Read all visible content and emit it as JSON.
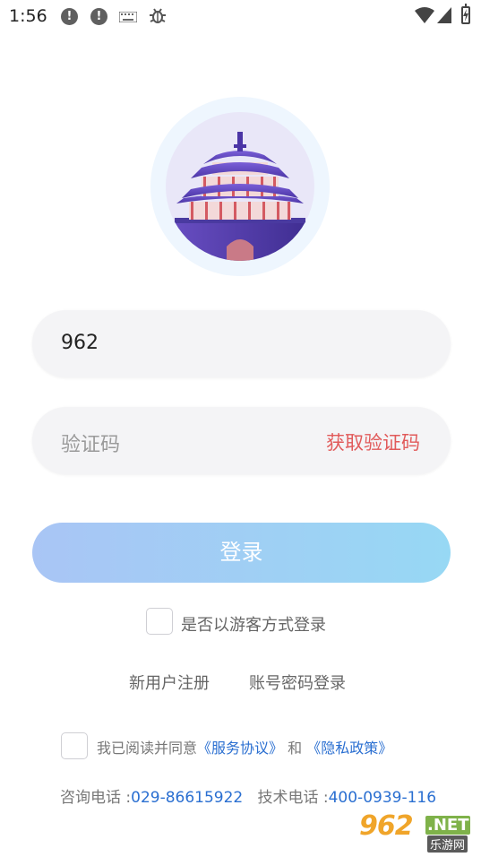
{
  "status_bar": {
    "time": "1:56",
    "icons": [
      "alert-icon",
      "alert-icon",
      "keyboard-icon",
      "bug-icon",
      "wifi-icon",
      "signal-icon",
      "battery-icon"
    ]
  },
  "logo": {
    "icon": "city-gate-tower-icon"
  },
  "phone_field": {
    "value": "962"
  },
  "code_field": {
    "placeholder": "验证码",
    "get_code_label": "获取验证码"
  },
  "login_button": {
    "label": "登录"
  },
  "guest": {
    "label": "是否以游客方式登录",
    "checked": false
  },
  "links": {
    "register": "新用户注册",
    "password_login": "账号密码登录"
  },
  "agreement": {
    "checked": false,
    "prefix": "我已阅读并同意",
    "service": "《服务协议》",
    "and": "和",
    "privacy": "《隐私政策》"
  },
  "contact": {
    "consult_label": "咨询电话 :",
    "consult_phone": "029-86615922",
    "tech_label": "技术电话 :",
    "tech_phone": "400-0939-116"
  },
  "watermark": {
    "big": "962",
    "net": ".NET",
    "cn": "乐游网"
  },
  "colors": {
    "accent_red": "#e15a5a",
    "link_blue": "#2a6fd1",
    "button_gradient_start": "#a9c5f5",
    "button_gradient_end": "#97d8f4"
  }
}
